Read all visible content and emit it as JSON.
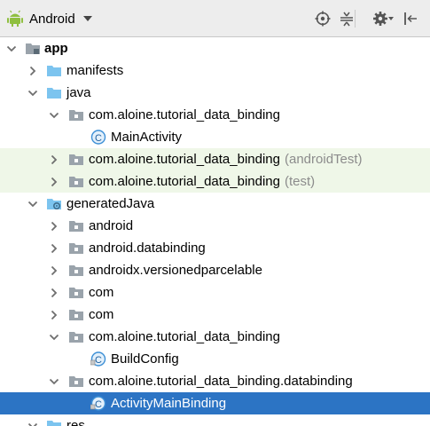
{
  "toolbar": {
    "view_label": "Android",
    "icons": [
      "android-icon",
      "locate-icon",
      "collapse-all-icon",
      "gear-icon",
      "hide-panel-icon"
    ]
  },
  "colors": {
    "selection": "#2c74c4",
    "highlight_row": "#eff7e8",
    "folder": "#7cc4ef",
    "package_folder": "#9aa3ab",
    "class_icon": "#3c8fd6",
    "suffix_text": "#8c8c8c"
  },
  "tree": [
    {
      "label": "app",
      "suffix": "",
      "state": "expanded",
      "icon": "module-icon",
      "bold": true
    },
    {
      "label": "manifests",
      "suffix": "",
      "state": "collapsed",
      "icon": "folder-icon"
    },
    {
      "label": "java",
      "suffix": "",
      "state": "expanded",
      "icon": "folder-icon"
    },
    {
      "label": "com.aloine.tutorial_data_binding",
      "suffix": "",
      "state": "expanded",
      "icon": "package-icon"
    },
    {
      "label": "MainActivity",
      "suffix": "",
      "state": "leaf",
      "icon": "class-icon"
    },
    {
      "label": "com.aloine.tutorial_data_binding",
      "suffix": "(androidTest)",
      "state": "collapsed",
      "icon": "package-icon",
      "highlight": true
    },
    {
      "label": "com.aloine.tutorial_data_binding",
      "suffix": "(test)",
      "state": "collapsed",
      "icon": "package-icon",
      "highlight": true
    },
    {
      "label": "generatedJava",
      "suffix": "",
      "state": "expanded",
      "icon": "generated-folder-icon"
    },
    {
      "label": "android",
      "suffix": "",
      "state": "collapsed",
      "icon": "package-icon"
    },
    {
      "label": "android.databinding",
      "suffix": "",
      "state": "collapsed",
      "icon": "package-icon"
    },
    {
      "label": "androidx.versionedparcelable",
      "suffix": "",
      "state": "collapsed",
      "icon": "package-icon"
    },
    {
      "label": "com",
      "suffix": "",
      "state": "collapsed",
      "icon": "package-icon"
    },
    {
      "label": "com",
      "suffix": "",
      "state": "collapsed",
      "icon": "package-icon"
    },
    {
      "label": "com.aloine.tutorial_data_binding",
      "suffix": "",
      "state": "expanded",
      "icon": "package-icon"
    },
    {
      "label": "BuildConfig",
      "suffix": "",
      "state": "leaf",
      "icon": "class-locked-icon"
    },
    {
      "label": "com.aloine.tutorial_data_binding.databinding",
      "suffix": "",
      "state": "expanded",
      "icon": "package-icon"
    },
    {
      "label": "ActivityMainBinding",
      "suffix": "",
      "state": "leaf",
      "icon": "class-locked-icon",
      "selected": true
    },
    {
      "label": "res",
      "suffix": "",
      "state": "expanded",
      "icon": "folder-icon"
    }
  ]
}
